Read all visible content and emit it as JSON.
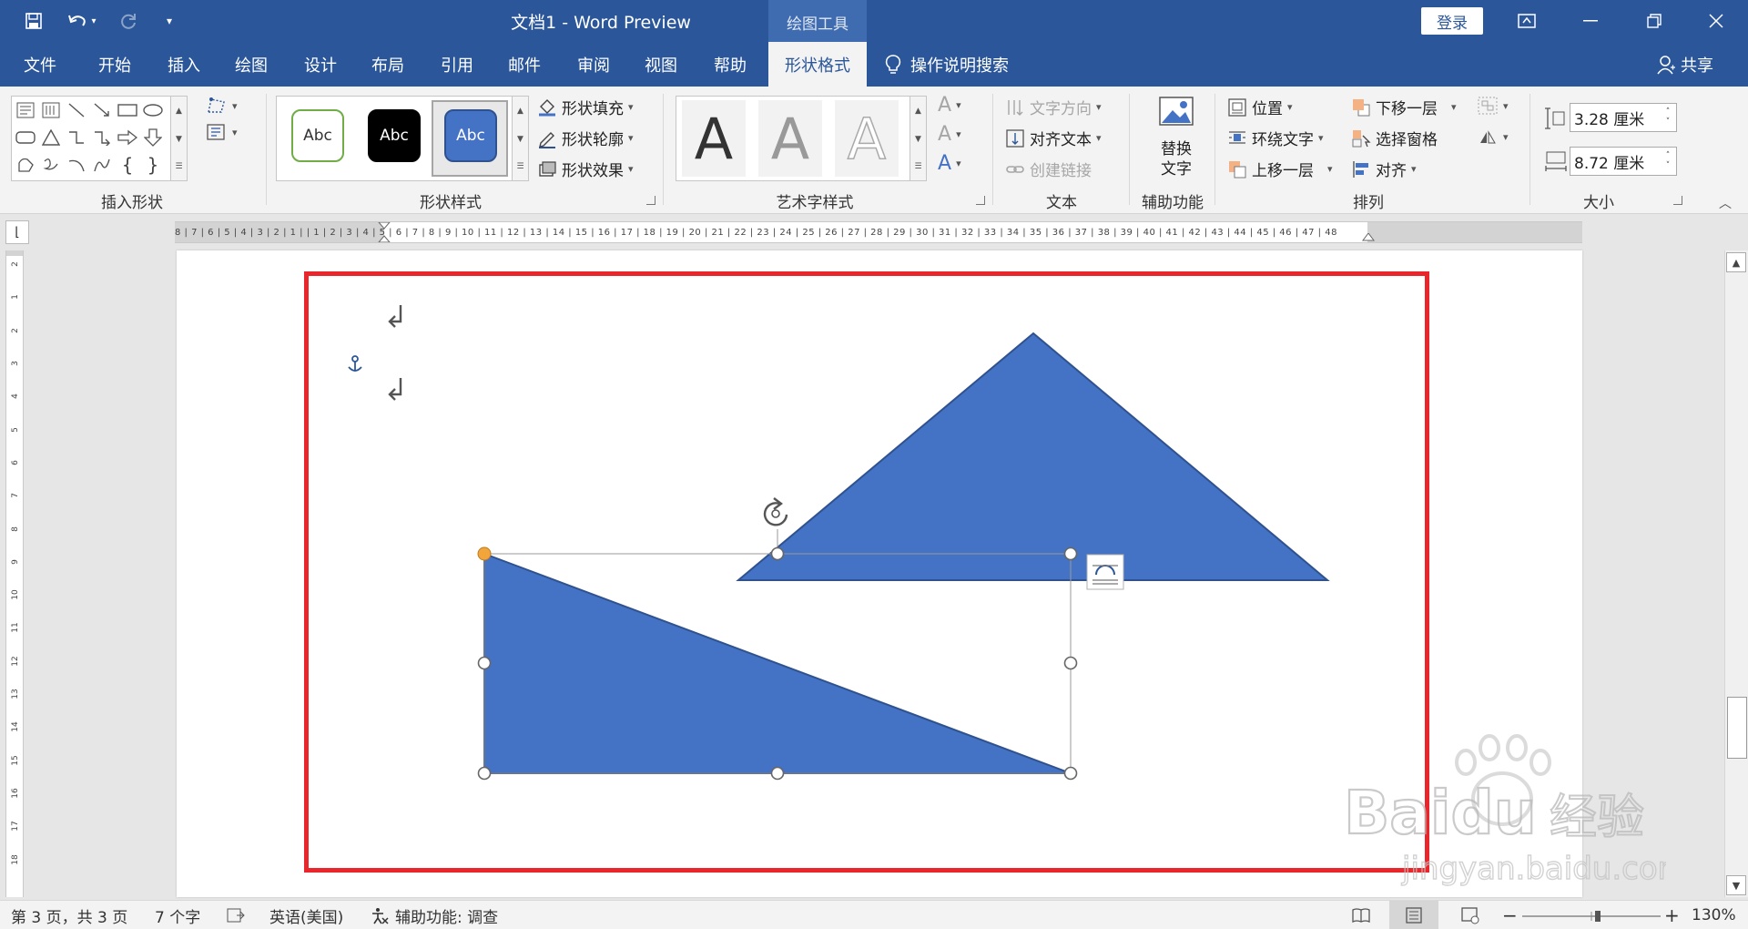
{
  "titlebar": {
    "title": "文档1  -  Word Preview",
    "context_tab": "绘图工具",
    "login": "登录"
  },
  "menu": {
    "items": [
      "文件",
      "开始",
      "插入",
      "绘图",
      "设计",
      "布局",
      "引用",
      "邮件",
      "审阅",
      "视图",
      "帮助"
    ],
    "active_tab": "形状格式",
    "tell_me": "操作说明搜索",
    "share": "共享"
  },
  "ribbon": {
    "insert_shapes": {
      "label": "插入形状"
    },
    "shape_styles": {
      "label": "形状样式",
      "swatch_text": "Abc",
      "fill": "形状填充",
      "outline": "形状轮廓",
      "effects": "形状效果"
    },
    "wordart": {
      "label": "艺术字样式",
      "letter": "A"
    },
    "text": {
      "label": "文本",
      "direction": "文字方向",
      "align": "对齐文本",
      "link": "创建链接"
    },
    "accessibility": {
      "label": "辅助功能",
      "alt_text_line1": "替换",
      "alt_text_line2": "文字"
    },
    "arrange": {
      "label": "排列",
      "position": "位置",
      "wrap": "环绕文字",
      "bring_forward": "上移一层",
      "send_backward": "下移一层",
      "selection_pane": "选择窗格",
      "align": "对齐"
    },
    "size": {
      "label": "大小",
      "height": "3.28 厘米",
      "width": "8.72 厘米"
    }
  },
  "ruler": {
    "horizontal": "8 | 7 | 6 | 5 | 4 | 3 | 2 | 1 |   | 1 | 2 | 3 | 4 | 5 | 6 | 7 | 8 | 9 | 10 | 11 | 12 | 13 | 14 | 15 | 16 | 17 | 18 | 19 | 20 | 21 | 22 | 23 | 24 | 25 | 26 | 27 | 28 | 29 | 30 | 31 | 32 | 33 | 34 | 35 | 36 | 37 | 38 | 39 | 40 | 41 | 42 | 43 | 44 | 45 | 46 | 47 | 48",
    "vertical": [
      "2",
      "1",
      "2",
      "3",
      "4",
      "5",
      "6",
      "7",
      "8",
      "9",
      "10",
      "11",
      "12",
      "13",
      "14",
      "15",
      "16",
      "17",
      "18"
    ]
  },
  "document": {
    "shape_color": "#4472c4",
    "shape_stroke": "#2f528f",
    "highlight_color": "#e8262b"
  },
  "status": {
    "page": "第 3 页，共 3 页",
    "words": "7 个字",
    "language": "英语(美国)",
    "accessibility": "辅助功能: 调查",
    "zoom": "130%"
  },
  "watermark": {
    "brand": "Baidu",
    "service": "经验",
    "url": "jingyan.baidu.com"
  }
}
